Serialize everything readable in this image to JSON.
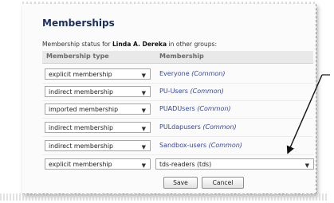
{
  "section": {
    "title": "Memberships"
  },
  "status": {
    "prefix": "Membership status for ",
    "user": "Linda A. Dereka",
    "suffix": " in other groups:"
  },
  "table": {
    "headers": {
      "type": "Membership type",
      "membership": "Membership"
    },
    "rows": [
      {
        "type": "explicit membership",
        "group": "Everyone",
        "scope": "(Common)"
      },
      {
        "type": "indirect membership",
        "group": "PU-Users",
        "scope": "(Common)"
      },
      {
        "type": "imported membership",
        "group": "PUADUsers",
        "scope": "(Common)"
      },
      {
        "type": "indirect membership",
        "group": "PULdapusers",
        "scope": "(Common)"
      },
      {
        "type": "indirect membership",
        "group": "Sandbox-users",
        "scope": "(Common)"
      }
    ],
    "new_row": {
      "type": "explicit membership",
      "group_selected": "tds-readers (tds)"
    }
  },
  "buttons": {
    "save": "Save",
    "cancel": "Cancel"
  },
  "icons": {
    "dropdown": "chevron-down-icon"
  },
  "colors": {
    "title": "#1b2f5e",
    "link": "#3346a6"
  }
}
